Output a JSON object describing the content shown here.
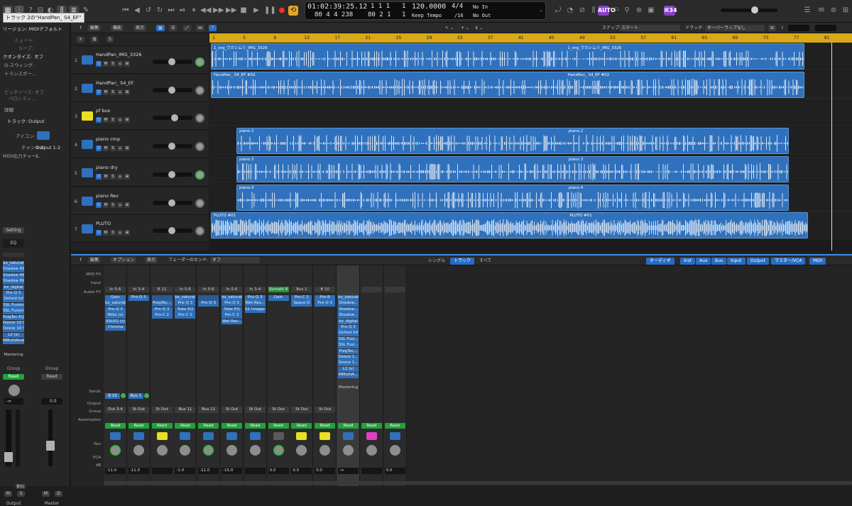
{
  "tooltip": "トラック 2の“HandPan_ S4_EF”",
  "lcd": {
    "time": "01:02:39:25.12",
    "bars": "1  1  1",
    "beat": "1",
    "tempo": "120.0000",
    "sig": "4/4",
    "in": "No In",
    "row2_smpte": "80  4  4  238",
    "row2_bars": "80  2  1",
    "row2_b": "1",
    "tempo_mode": "Keep Tempo",
    "div": "/16",
    "out": "No Out"
  },
  "topbar": {
    "auto_badge": "AUTO",
    "count_badge": "⌘34"
  },
  "inspector": {
    "region_title": "リージョン: MIDIデフォルト",
    "mute": "ミュート:",
    "loop": "ループ:",
    "quantize_label": "クオンタイズ:",
    "quantize_val": "オフ",
    "qswing": "Q-スウィング:",
    "transpose": "トランスポー...",
    "velocity_src": "ピッチソース: オフ",
    "velocity": "ベロシティ...",
    "detail": "詳細",
    "track_label": "トラック:",
    "track_val": "Output",
    "icon_label": "アイコン:",
    "channel_label": "チャンネル:",
    "channel_val": "Output 1-2",
    "midi_out": "MIDI出力チャー...",
    "midi_out_val": "1",
    "setting": "Setting",
    "eq": "EQ",
    "plugins": [
      "bx_saturat",
      "Shadow Hil",
      "Shadow Hil",
      "Shadow Hil",
      "bx_digital",
      "Pro-Q 3",
      "Oxford Inf",
      "SSL Fusion",
      "SSL Fusion",
      "PuigTec EQ",
      "Ozone 10 S",
      "Ozone 10 S",
      "L2 (s)",
      "MMultiAnal"
    ],
    "mastering": "Mastering",
    "group": "Group",
    "read": "Read",
    "left_db": "-∞",
    "right_db": "0.0",
    "bnc": "Bnc",
    "m": "M",
    "s": "S",
    "d": "D",
    "output_name": "Output",
    "master_name": "Master"
  },
  "arrange_bar": {
    "edit": "編集",
    "function": "機能",
    "view": "表示",
    "snap_label": "スナップ:",
    "snap_val": "スマート",
    "drag_label": "ドラッグ:",
    "drag_val": "オーバーラップなし"
  },
  "ruler": [
    "1",
    "5",
    "9",
    "13",
    "17",
    "21",
    "25",
    "29",
    "33",
    "37",
    "41",
    "45",
    "49",
    "53",
    "57",
    "61",
    "65",
    "69",
    "73",
    "77",
    "81"
  ],
  "tracks": [
    {
      "num": "1",
      "name": "HandPan_IMG_3326",
      "color": "#2f71bd",
      "knobgreen": true,
      "regions": [
        {
          "name": "1_org_ウカシムリ_IMG_3326",
          "name2": "1_org_ウカシムリ_IMG_3326"
        }
      ]
    },
    {
      "num": "2",
      "name": "HandPan_ S4_EF",
      "color": "#2f71bd",
      "knobgreen": false,
      "regions": [
        {
          "name": "HandPan_ S4_EF #02",
          "name2": "HandPan_ S4_EF #02"
        }
      ]
    },
    {
      "num": "3",
      "name": "pf bus",
      "color": "#e8e020",
      "knobgreen": false,
      "regions": []
    },
    {
      "num": "4",
      "name": "piano  cmp",
      "color": "#2f71bd",
      "knobgreen": false,
      "regions": [
        {
          "name": "piano.2",
          "name2": "piano.2"
        }
      ]
    },
    {
      "num": "5",
      "name": "piano   dry",
      "color": "#2f71bd",
      "knobgreen": true,
      "regions": [
        {
          "name": "piano.3",
          "name2": "piano.3"
        }
      ]
    },
    {
      "num": "6",
      "name": "piano   Rev",
      "color": "#2f71bd",
      "knobgreen": false,
      "regions": [
        {
          "name": "piano.4",
          "name2": "piano.4"
        }
      ]
    },
    {
      "num": "7",
      "name": "PLUTO",
      "color": "#2f71bd",
      "knobgreen": false,
      "regions": [
        {
          "name": "PLUTO #01",
          "name2": "PLUTO #01"
        }
      ]
    }
  ],
  "mixer_bar": {
    "edit": "編集",
    "options": "オプション",
    "view": "表示",
    "sends_label": "フェーダーのセンド:",
    "sends_val": "オフ",
    "tabs": [
      "シングル",
      "トラック",
      "すべて"
    ],
    "filters": [
      "オーディオ",
      "Inst",
      "Aux",
      "Bus",
      "Input",
      "Output",
      "マスター/VCA",
      "MIDI"
    ]
  },
  "mixer_labels": {
    "midifx": "MIDI FX",
    "input": "Input",
    "audiofx": "Audio FX",
    "sends": "Sends",
    "output": "Output",
    "group": "Group",
    "automation": "Automation",
    "pan": "Pan",
    "vca": "VCA",
    "db": "dB"
  },
  "strips": [
    {
      "in": "In 5-6",
      "plugs": [
        "Gain",
        "bx_saturat",
        "Pro-Q 3",
        "RVox (s)",
        "SSLEQ (s)",
        "Chroma"
      ],
      "send": "B 10",
      "out": "Out 3-4",
      "read": "Read",
      "color": "#2f71bd",
      "db": "-11.0",
      "green": true
    },
    {
      "in": "In 3-4",
      "plugs": [
        "Pro-Q 3"
      ],
      "send": "Bus 1",
      "out": "St Out",
      "read": "Read",
      "color": "#2f71bd",
      "db": "-11.0",
      "green": false
    },
    {
      "in": "B 11",
      "plugs": [
        "",
        "PuigTec...",
        "Pro-Q 3",
        "Pro-C 2"
      ],
      "send": "",
      "out": "St Out",
      "read": "Read",
      "color": "#e8e020",
      "db": "",
      "green": false
    },
    {
      "in": "In 5-6",
      "plugs": [
        "bx_saturat",
        "Pro-Q 3",
        "Tube EQ",
        "Pro-C 2"
      ],
      "send": "",
      "out": "Bus 11",
      "read": "Read",
      "color": "#2f71bd",
      "db": "-1.0",
      "green": false
    },
    {
      "in": "In 5-6",
      "plugs": [
        "",
        "Pro-Q 3"
      ],
      "send": "",
      "out": "Bus 11",
      "read": "Read",
      "color": "#2f71bd",
      "db": "-11.0",
      "green": true
    },
    {
      "in": "In 5-6",
      "plugs": [
        "bx_saturat",
        "Pro-Q 3",
        "Tube EQ",
        "Pro-C 2",
        "Wet Rev..."
      ],
      "send": "",
      "out": "St Out",
      "read": "Read",
      "color": "#2f71bd",
      "db": "-15.0",
      "green": false
    },
    {
      "in": "In 3-4",
      "plugs": [
        "Pro-Q 3",
        "Wet Rev...",
        "S1 Imager"
      ],
      "send": "",
      "out": "St Out",
      "read": "Read",
      "color": "#2f71bd",
      "db": "",
      "green": false
    },
    {
      "in": "Kontakt 8",
      "plugs": [
        "Gain"
      ],
      "send": "",
      "out": "St Out",
      "read": "Read",
      "color": "#5a5a5a",
      "db": "0.0",
      "green": true
    },
    {
      "in": "Bus 1",
      "plugs": [
        "Pro-C 2",
        "Space D"
      ],
      "send": "",
      "out": "St Out",
      "read": "Read",
      "color": "#e8e020",
      "db": "0.0",
      "green": false
    },
    {
      "in": "B 10",
      "plugs": [
        "Pro-R",
        "Pro-Q 3"
      ],
      "send": "",
      "out": "St Out",
      "read": "Read",
      "color": "#e8e020",
      "db": "0.0",
      "green": false
    },
    {
      "in": "",
      "plugs": [
        "bx_saturat",
        "Shadow...",
        "Shadow...",
        "Shadow...",
        "bx_digital",
        "Pro-Q 3",
        "Oxford Inf",
        "SSL Fusi...",
        "SSL Fusi...",
        "PuigTec...",
        "Ozone 1...",
        "Ozone 1...",
        "L2 (s)",
        "MMultiA..."
      ],
      "send": "",
      "out": "",
      "read": "Read",
      "color": "#2f71bd",
      "db": "-∞",
      "green": false,
      "mastering": "Mastering"
    },
    {
      "in": "",
      "plugs": [],
      "send": "",
      "out": "",
      "read": "Read",
      "color": "#e040c0",
      "db": "",
      "green": false
    },
    {
      "in": "",
      "plugs": [],
      "send": "",
      "out": "",
      "read": "Read",
      "color": "#2f71bd",
      "db": "0.0",
      "green": false
    }
  ]
}
